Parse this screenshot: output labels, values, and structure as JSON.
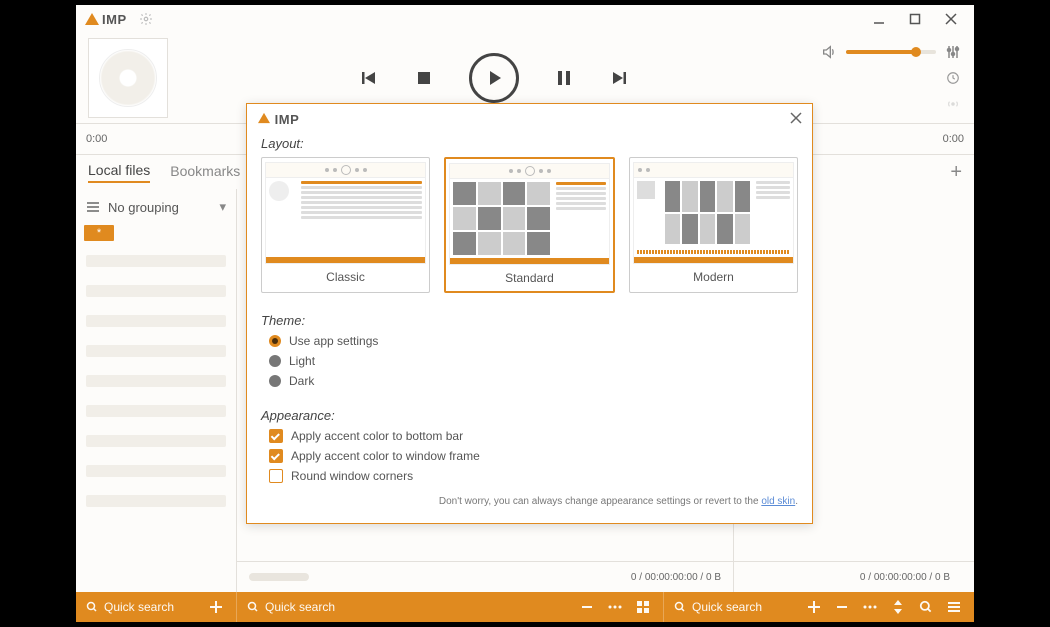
{
  "app": {
    "name": "IMP"
  },
  "time": {
    "left": "0:00",
    "right": "0:00"
  },
  "tabs": {
    "local": "Local files",
    "bookmarks": "Bookmarks"
  },
  "grouping": {
    "label": "No grouping",
    "star": "*"
  },
  "footer": {
    "count_mid": "0 / 00:00:00:00 / 0 B",
    "count_right": "0 / 00:00:00:00 / 0 B"
  },
  "search": {
    "ph_left": "Quick search",
    "ph_mid": "Quick search",
    "ph_right": "Quick search"
  },
  "dialog": {
    "layout_label": "Layout:",
    "layouts": {
      "classic": "Classic",
      "standard": "Standard",
      "modern": "Modern"
    },
    "theme_label": "Theme:",
    "theme": {
      "app": "Use app settings",
      "light": "Light",
      "dark": "Dark"
    },
    "appearance_label": "Appearance:",
    "appearance": {
      "accent_bottom": "Apply accent color to bottom bar",
      "accent_frame": "Apply accent color to window frame",
      "round_corners": "Round window corners"
    },
    "hint_prefix": "Don't worry, you can always change appearance settings or revert to the ",
    "hint_link": "old skin",
    "hint_suffix": "."
  }
}
